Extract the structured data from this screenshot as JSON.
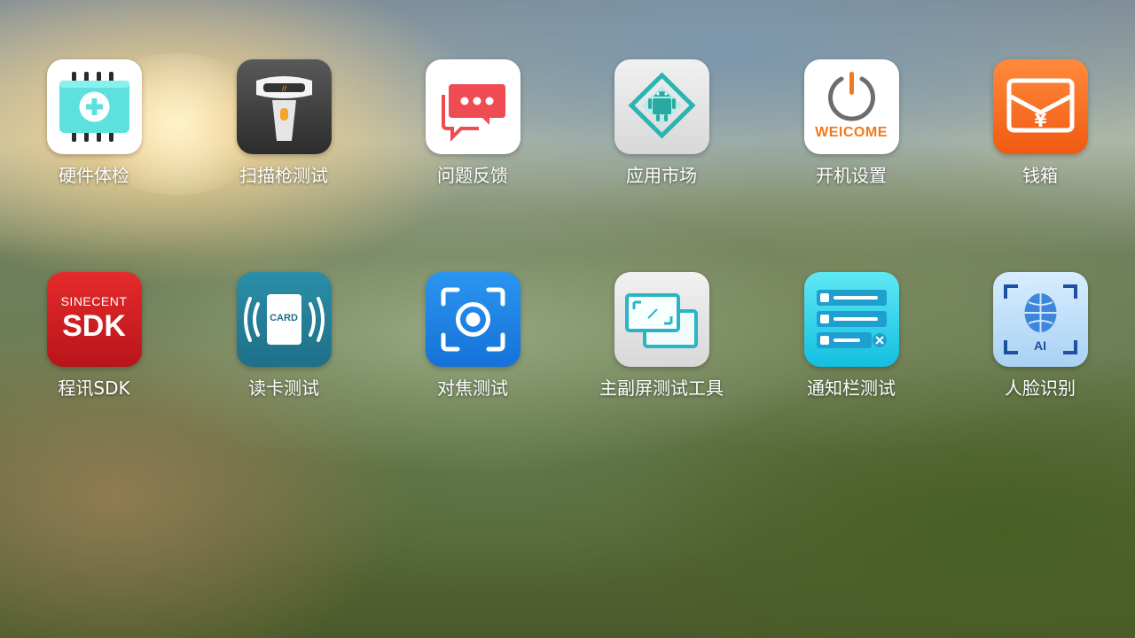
{
  "apps": [
    {
      "label": "硬件体检",
      "icon": "hardware-check-icon"
    },
    {
      "label": "扫描枪测试",
      "icon": "barcode-scanner-icon"
    },
    {
      "label": "问题反馈",
      "icon": "chat-bubble-icon"
    },
    {
      "label": "应用市场",
      "icon": "android-icon"
    },
    {
      "label": "开机设置",
      "icon": "power-icon",
      "badge_text": "WEICOME"
    },
    {
      "label": "钱箱",
      "icon": "cash-drawer-icon"
    },
    {
      "label": "程讯SDK",
      "icon": "sdk-icon",
      "badge_small": "SINECENT",
      "badge_big": "SDK"
    },
    {
      "label": "读卡测试",
      "icon": "card-reader-icon",
      "badge_text": "CARD"
    },
    {
      "label": "对焦测试",
      "icon": "focus-icon"
    },
    {
      "label": "主副屏测试工具",
      "icon": "dual-screen-icon"
    },
    {
      "label": "通知栏测试",
      "icon": "notification-list-icon"
    },
    {
      "label": "人脸识别",
      "icon": "face-recognition-icon",
      "badge_text": "AI"
    }
  ],
  "colors": {
    "orange": "#f05a12",
    "red": "#b8141a",
    "teal": "#1f6f88",
    "blue": "#1572d8",
    "cyan": "#14bfe0"
  }
}
